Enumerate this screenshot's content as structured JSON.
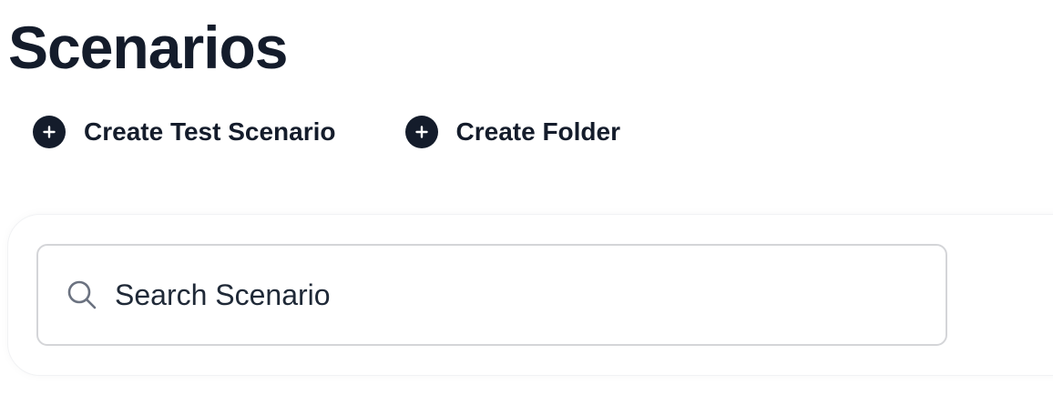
{
  "page": {
    "title": "Scenarios"
  },
  "actions": {
    "create_test_scenario_label": "Create Test Scenario",
    "create_folder_label": "Create Folder"
  },
  "search": {
    "placeholder": "Search Scenario"
  },
  "icons": {
    "create_test_scenario": "plus-circle-icon",
    "create_folder": "plus-circle-icon",
    "search": "search-icon"
  },
  "colors": {
    "text_primary": "#141c2b",
    "icon_background": "#141c2b",
    "search_border": "#d4d5d8",
    "panel_background": "#ffffff"
  }
}
